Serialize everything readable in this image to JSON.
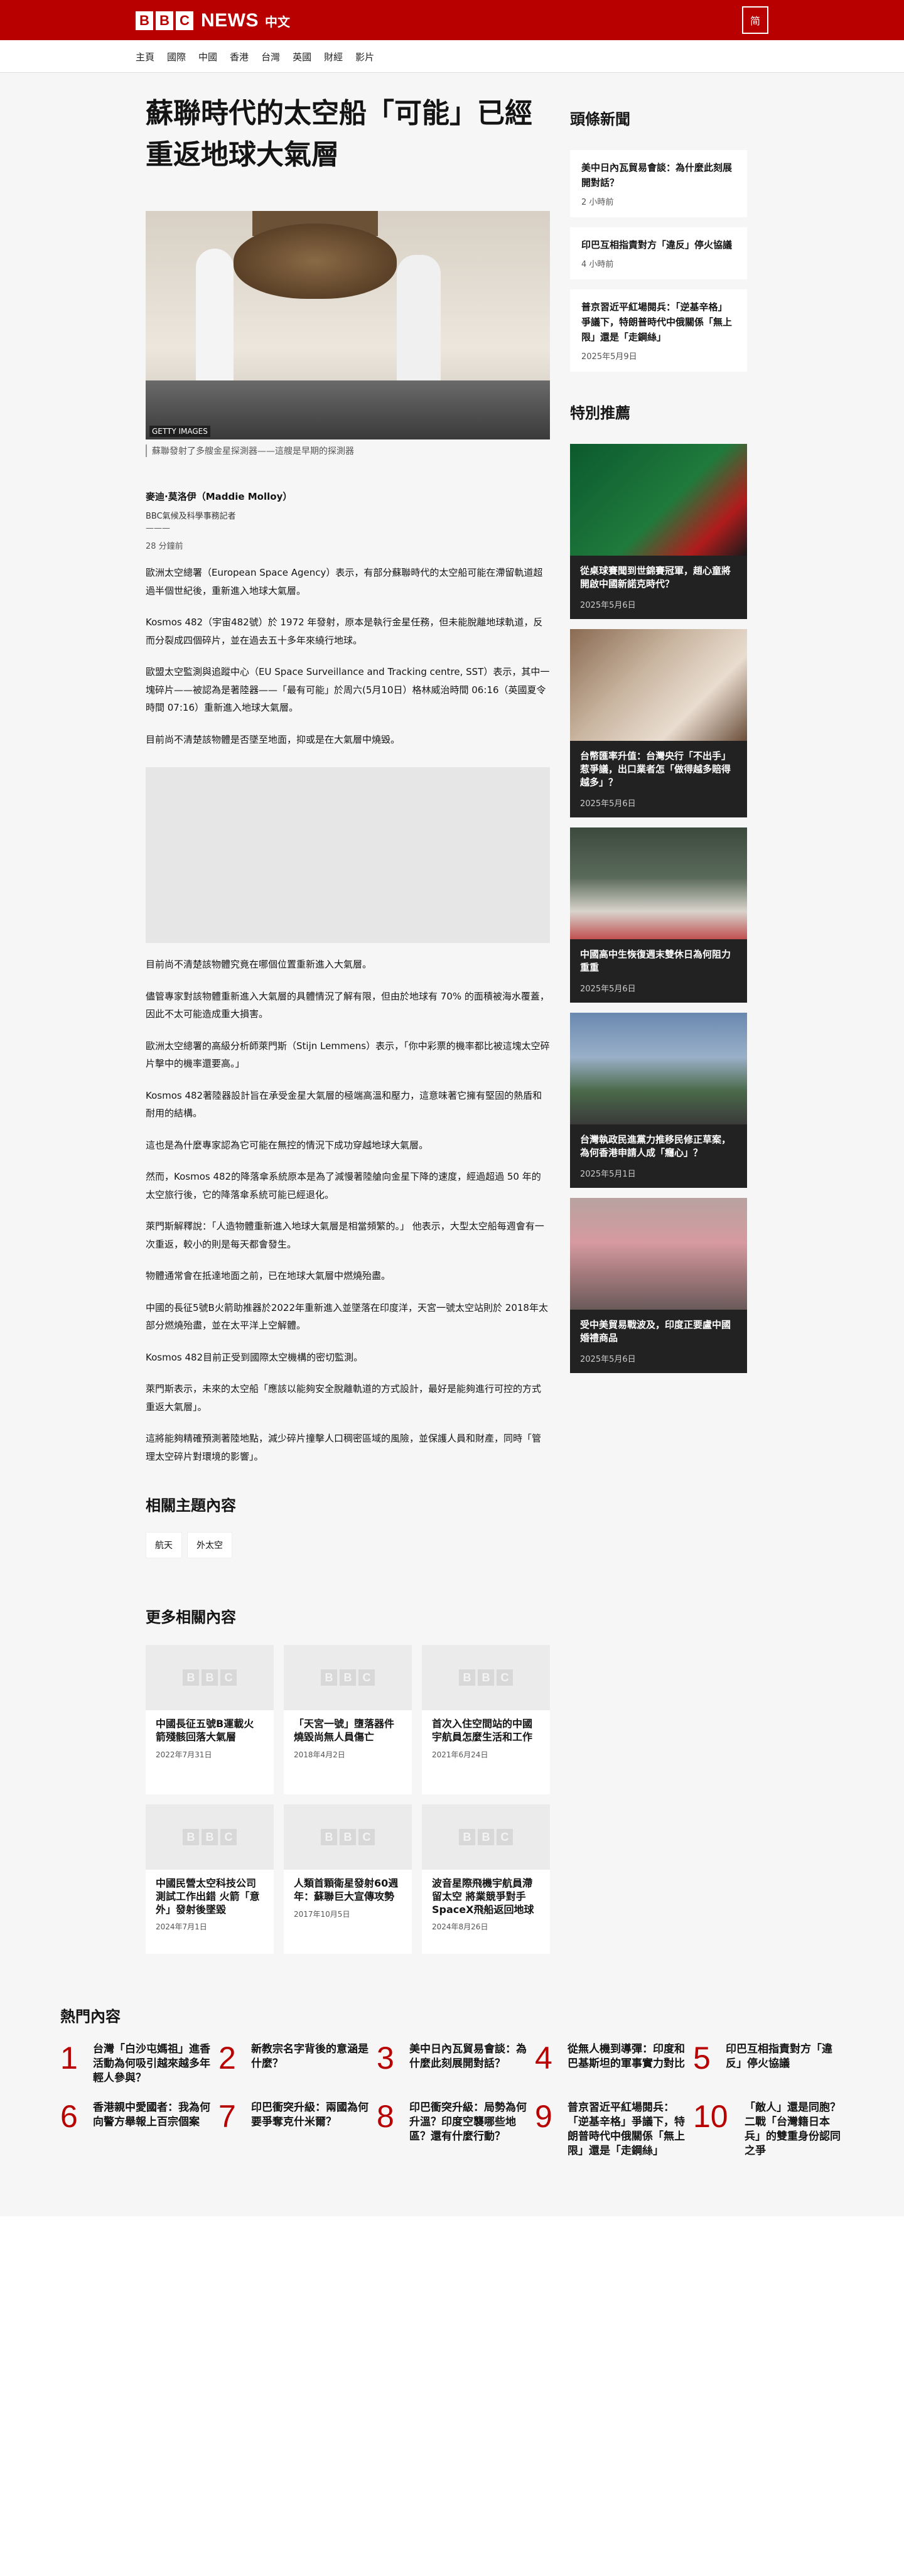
{
  "header": {
    "brand_letters": [
      "B",
      "B",
      "C"
    ],
    "brand_news": "NEWS",
    "brand_zh": "中文",
    "lang_toggle": "简"
  },
  "nav": {
    "items": [
      "主頁",
      "國際",
      "中國",
      "香港",
      "台灣",
      "英國",
      "財經",
      "影片"
    ]
  },
  "article": {
    "headline": "蘇聯時代的太空船「可能」已經重返地球大氣層",
    "image_credit": "GETTY IMAGES",
    "caption": "蘇聯發射了多艘金星探測器——這艘是早期的探測器",
    "author": "麥迪·莫洛伊（Maddie Molloy）",
    "role": "BBC氣候及科學事務記者",
    "dash": "———",
    "time": "28 分鐘前",
    "paragraphs_before": [
      "歐洲太空總署（European Space Agency）表示，有部分蘇聯時代的太空船可能在滯留軌道超過半個世紀後，重新進入地球大氣層。",
      "Kosmos 482（宇宙482號）於 1972 年發射，原本是執行金星任務，但未能脫離地球軌道，反而分裂成四個碎片，並在過去五十多年來繞行地球。",
      "歐盟太空監測與追蹤中心（EU Space Surveillance and Tracking centre, SST）表示，其中一塊碎片——被認為是著陸器——「最有可能」於周六(5月10日）格林威治時間 06:16（英國夏令時間 07:16）重新進入地球大氣層。",
      "目前尚不清楚該物體是否墜至地面，抑或是在大氣層中燒毀。"
    ],
    "paragraphs_after": [
      "目前尚不清楚該物體究竟在哪個位置重新進入大氣層。",
      "儘管專家對該物體重新進入大氣層的具體情況了解有限，但由於地球有 70% 的面積被海水覆蓋，因此不太可能造成重大損害。",
      "歐洲太空總署的高級分析師萊門斯（Stijn Lemmens）表示，「你中彩票的機率都比被這塊太空碎片擊中的機率還要高。」",
      "Kosmos 482著陸器設計旨在承受金星大氣層的極端高溫和壓力，這意味著它擁有堅固的熱盾和耐用的結構。",
      "這也是為什麼專家認為它可能在無控的情況下成功穿越地球大氣層。",
      "然而，Kosmos 482的降落傘系統原本是為了減慢著陸艙向金星下降的速度，經過超過 50 年的太空旅行後，它的降落傘系統可能已經退化。",
      "萊門斯解釋說：「人造物體重新進入地球大氣層是相當頻繁的。」 他表示，大型太空船每週會有一次重返，較小的則是每天都會發生。",
      "物體通常會在抵達地面之前，已在地球大氣層中燃燒殆盡。",
      "中國的長征5號B火箭助推器於2022年重新進入並墜落在印度洋，天宮一號太空站則於 2018年太部分燃燒殆盡，並在太平洋上空解體。",
      "Kosmos 482目前正受到國際太空機構的密切監測。",
      "萊門斯表示，未來的太空船「應該以能夠安全脫離軌道的方式設計，最好是能夠進行可控的方式重返大氣層」。",
      "這將能夠精確預測著陸地點，減少碎片撞擊人口稠密區域的風險，並保護人員和財產，同時「管理太空碎片對環境的影響」。"
    ]
  },
  "tags": {
    "title": "相關主題內容",
    "items": [
      "航天",
      "外太空"
    ]
  },
  "more": {
    "title": "更多相關內容",
    "cards": [
      {
        "title": "中國長征五號B運載火箭殘骸回落大氣層",
        "date": "2022年7月31日"
      },
      {
        "title": "「天宮一號」墮落器件燒毀尚無人員傷亡",
        "date": "2018年4月2日"
      },
      {
        "title": "首次入住空間站的中國宇航員怎麼生活和工作",
        "date": "2021年6月24日"
      },
      {
        "title": "中國民營太空科技公司測試工作出錯 火箭「意外」發射後墜毀",
        "date": "2024年7月1日"
      },
      {
        "title": "人類首顆衛星發射60週年：蘇聯巨大宣傳攻勢",
        "date": "2017年10月5日"
      },
      {
        "title": "波音星際飛機宇航員滯留太空 將業競爭對手SpaceX飛船返回地球",
        "date": "2024年8月26日"
      }
    ]
  },
  "sidebar": {
    "headlines_title": "頭條新聞",
    "headlines": [
      {
        "title": "美中日內瓦貿易會談：為什麼此刻展開對話？",
        "date": "2 小時前"
      },
      {
        "title": "印巴互相指責對方「違反」停火協議",
        "date": "4 小時前"
      },
      {
        "title": "普京習近平紅場閱兵：「逆基辛格」爭議下，特朗普時代中俄關係「無上限」還是「走鋼絲」",
        "date": "2025年5月9日"
      }
    ],
    "special_title": "特別推薦",
    "special": [
      {
        "title": "從桌球賽聞到世錦賽冠軍，趙心童將開啟中國新諾克時代？",
        "date": "2025年5月6日"
      },
      {
        "title": "台幣匯率升值：台灣央行「不出手」惹爭議，出口業者怎「做得越多賠得越多」？",
        "date": "2025年5月6日"
      },
      {
        "title": "中國高中生恢復週末雙休日為何阻力重重",
        "date": "2025年5月6日"
      },
      {
        "title": "台灣執政民進黨力推移民修正草案，為何香港申請人成「癮心」？",
        "date": "2025年5月1日"
      },
      {
        "title": "受中美貿易戰波及，印度正要盧中國婚禮商品",
        "date": "2025年5月6日"
      }
    ]
  },
  "popular": {
    "title": "熱門內容",
    "items": [
      {
        "num": "1",
        "title": "台灣「白沙屯媽祖」進香活動為何吸引越來越多年輕人參與？"
      },
      {
        "num": "2",
        "title": "新教宗名字背後的意涵是什麼？"
      },
      {
        "num": "3",
        "title": "美中日內瓦貿易會談：為什麼此刻展開對話？"
      },
      {
        "num": "4",
        "title": "從無人機到導彈：印度和巴基斯坦的軍事實力對比"
      },
      {
        "num": "5",
        "title": "印巴互相指責對方「違反」停火協議"
      },
      {
        "num": "6",
        "title": "香港親中愛國者：我為何向警方舉報上百宗個案"
      },
      {
        "num": "7",
        "title": "印巴衝突升級：兩國為何要爭奪克什米爾？"
      },
      {
        "num": "8",
        "title": "印巴衝突升級：局勢為何升溫？印度空襲哪些地區？還有什麼行動？"
      },
      {
        "num": "9",
        "title": "普京習近平紅場閱兵：「逆基辛格」爭議下，特朗普時代中俄關係「無上限」還是「走鋼絲」"
      },
      {
        "num": "10",
        "title": "「敵人」還是同胞？二戰「台灣籍日本兵」的雙重身份認同之爭"
      }
    ]
  },
  "colors": {
    "brand_red": "#b80000",
    "page_bg": "#f6f6f6",
    "dark_card": "#222222"
  }
}
